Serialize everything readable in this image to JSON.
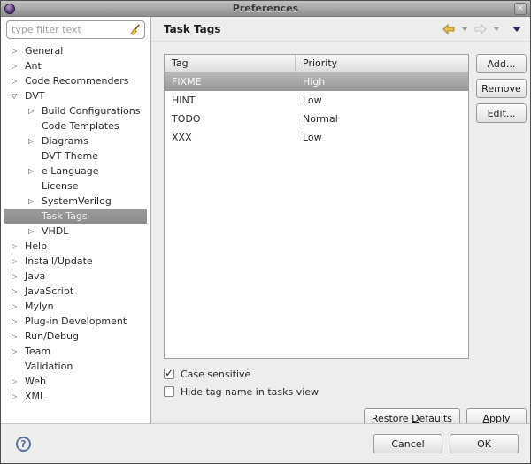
{
  "window": {
    "title": "Preferences",
    "close_glyph": "✕"
  },
  "sidebar": {
    "filter_placeholder": "type filter text",
    "tree": [
      {
        "label": "General",
        "level": 0,
        "expander": "collapsed"
      },
      {
        "label": "Ant",
        "level": 0,
        "expander": "collapsed"
      },
      {
        "label": "Code Recommenders",
        "level": 0,
        "expander": "collapsed"
      },
      {
        "label": "DVT",
        "level": 0,
        "expander": "expanded"
      },
      {
        "label": "Build Configurations",
        "level": 1,
        "expander": "collapsed"
      },
      {
        "label": "Code Templates",
        "level": 1,
        "expander": "none"
      },
      {
        "label": "Diagrams",
        "level": 1,
        "expander": "collapsed"
      },
      {
        "label": "DVT Theme",
        "level": 1,
        "expander": "none"
      },
      {
        "label": "e Language",
        "level": 1,
        "expander": "collapsed"
      },
      {
        "label": "License",
        "level": 1,
        "expander": "none"
      },
      {
        "label": "SystemVerilog",
        "level": 1,
        "expander": "collapsed"
      },
      {
        "label": "Task Tags",
        "level": 1,
        "expander": "none",
        "selected": true
      },
      {
        "label": "VHDL",
        "level": 1,
        "expander": "collapsed"
      },
      {
        "label": "Help",
        "level": 0,
        "expander": "collapsed"
      },
      {
        "label": "Install/Update",
        "level": 0,
        "expander": "collapsed"
      },
      {
        "label": "Java",
        "level": 0,
        "expander": "collapsed"
      },
      {
        "label": "JavaScript",
        "level": 0,
        "expander": "collapsed"
      },
      {
        "label": "Mylyn",
        "level": 0,
        "expander": "collapsed"
      },
      {
        "label": "Plug-in Development",
        "level": 0,
        "expander": "collapsed"
      },
      {
        "label": "Run/Debug",
        "level": 0,
        "expander": "collapsed"
      },
      {
        "label": "Team",
        "level": 0,
        "expander": "collapsed"
      },
      {
        "label": "Validation",
        "level": 0,
        "expander": "none"
      },
      {
        "label": "Web",
        "level": 0,
        "expander": "collapsed"
      },
      {
        "label": "XML",
        "level": 0,
        "expander": "collapsed"
      }
    ]
  },
  "page": {
    "title": "Task Tags",
    "table": {
      "columns": [
        "Tag",
        "Priority"
      ],
      "rows": [
        {
          "tag": "FIXME",
          "priority": "High",
          "selected": true
        },
        {
          "tag": "HINT",
          "priority": "Low",
          "selected": false
        },
        {
          "tag": "TODO",
          "priority": "Normal",
          "selected": false
        },
        {
          "tag": "XXX",
          "priority": "Low",
          "selected": false
        }
      ]
    },
    "side_buttons": [
      {
        "label": "Add..."
      },
      {
        "label": "Remove"
      },
      {
        "label": "Edit..."
      }
    ],
    "checkboxes": [
      {
        "label": "Case sensitive",
        "checked": true
      },
      {
        "label": "Hide tag name in tasks view",
        "checked": false
      }
    ],
    "action_buttons": [
      {
        "label": "Restore Defaults",
        "mnemonic": "D"
      },
      {
        "label": "Apply",
        "mnemonic": "A"
      }
    ]
  },
  "footer": {
    "help_glyph": "?",
    "cancel_label": "Cancel",
    "ok_label": "OK"
  },
  "colors": {
    "selection_gray": "#979797",
    "back_arrow_gold": "#e3bf4e",
    "view_menu_navy": "#2b2b63",
    "help_blue": "#5a74a0",
    "titlebar_gray": "#8d8d8d"
  }
}
